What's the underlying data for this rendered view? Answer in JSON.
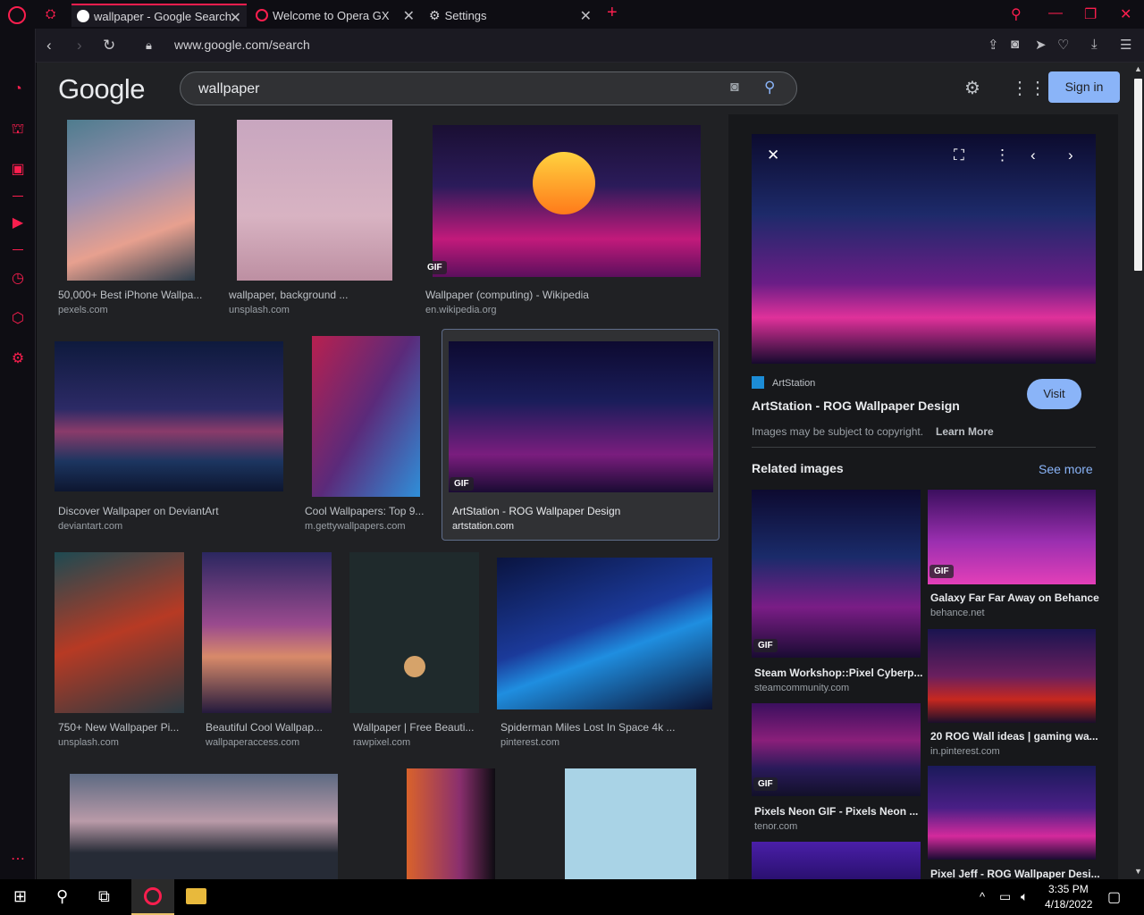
{
  "tabs": [
    {
      "label": "wallpaper - Google Search",
      "active": true
    },
    {
      "label": "Welcome to Opera GX",
      "active": false
    },
    {
      "label": "Settings",
      "active": false
    }
  ],
  "address": {
    "url": "www.google.com/search"
  },
  "google": {
    "logo": "Google",
    "query": "wallpaper",
    "signin": "Sign in"
  },
  "results": [
    {
      "title": "50,000+ Best iPhone Wallpa...",
      "source": "pexels.com"
    },
    {
      "title": "wallpaper, background ...",
      "source": "unsplash.com"
    },
    {
      "title": "Wallpaper (computing) - Wikipedia",
      "source": "en.wikipedia.org",
      "badge": "GIF"
    },
    {
      "title": "Discover Wallpaper on DeviantArt",
      "source": "deviantart.com"
    },
    {
      "title": "Cool Wallpapers: Top 9...",
      "source": "m.gettywallpapers.com"
    },
    {
      "title": "ArtStation - ROG Wallpaper Design",
      "source": "artstation.com",
      "badge": "GIF"
    },
    {
      "title": "750+ New Wallpaper Pi...",
      "source": "unsplash.com"
    },
    {
      "title": "Beautiful Cool Wallpap...",
      "source": "wallpaperaccess.com"
    },
    {
      "title": "Wallpaper | Free Beauti...",
      "source": "rawpixel.com"
    },
    {
      "title": "Spiderman Miles Lost In Space 4k ...",
      "source": "pinterest.com"
    }
  ],
  "panel": {
    "site": "ArtStation",
    "title": "ArtStation - ROG Wallpaper Design",
    "visit": "Visit",
    "copyright": "Images may be subject to copyright.",
    "learn_more": "Learn More",
    "related_heading": "Related images",
    "see_more": "See more",
    "related": [
      {
        "title": "Steam Workshop::Pixel Cyberp...",
        "source": "steamcommunity.com",
        "badge": "GIF"
      },
      {
        "title": "Galaxy Far Far Away on Behance",
        "source": "behance.net",
        "badge": "GIF"
      },
      {
        "title": "20 ROG Wall ideas | gaming wa...",
        "source": "in.pinterest.com"
      },
      {
        "title": "Pixels Neon GIF - Pixels Neon ...",
        "source": "tenor.com",
        "badge": "GIF"
      },
      {
        "title": "Pixel Jeff - ROG Wallpaper Desi...",
        "source": ""
      }
    ]
  },
  "taskbar": {
    "time": "3:35 PM",
    "date": "4/18/2022"
  },
  "colors": {
    "accent": "#fa1e4e",
    "link": "#8ab4f8",
    "bg": "#202124"
  }
}
